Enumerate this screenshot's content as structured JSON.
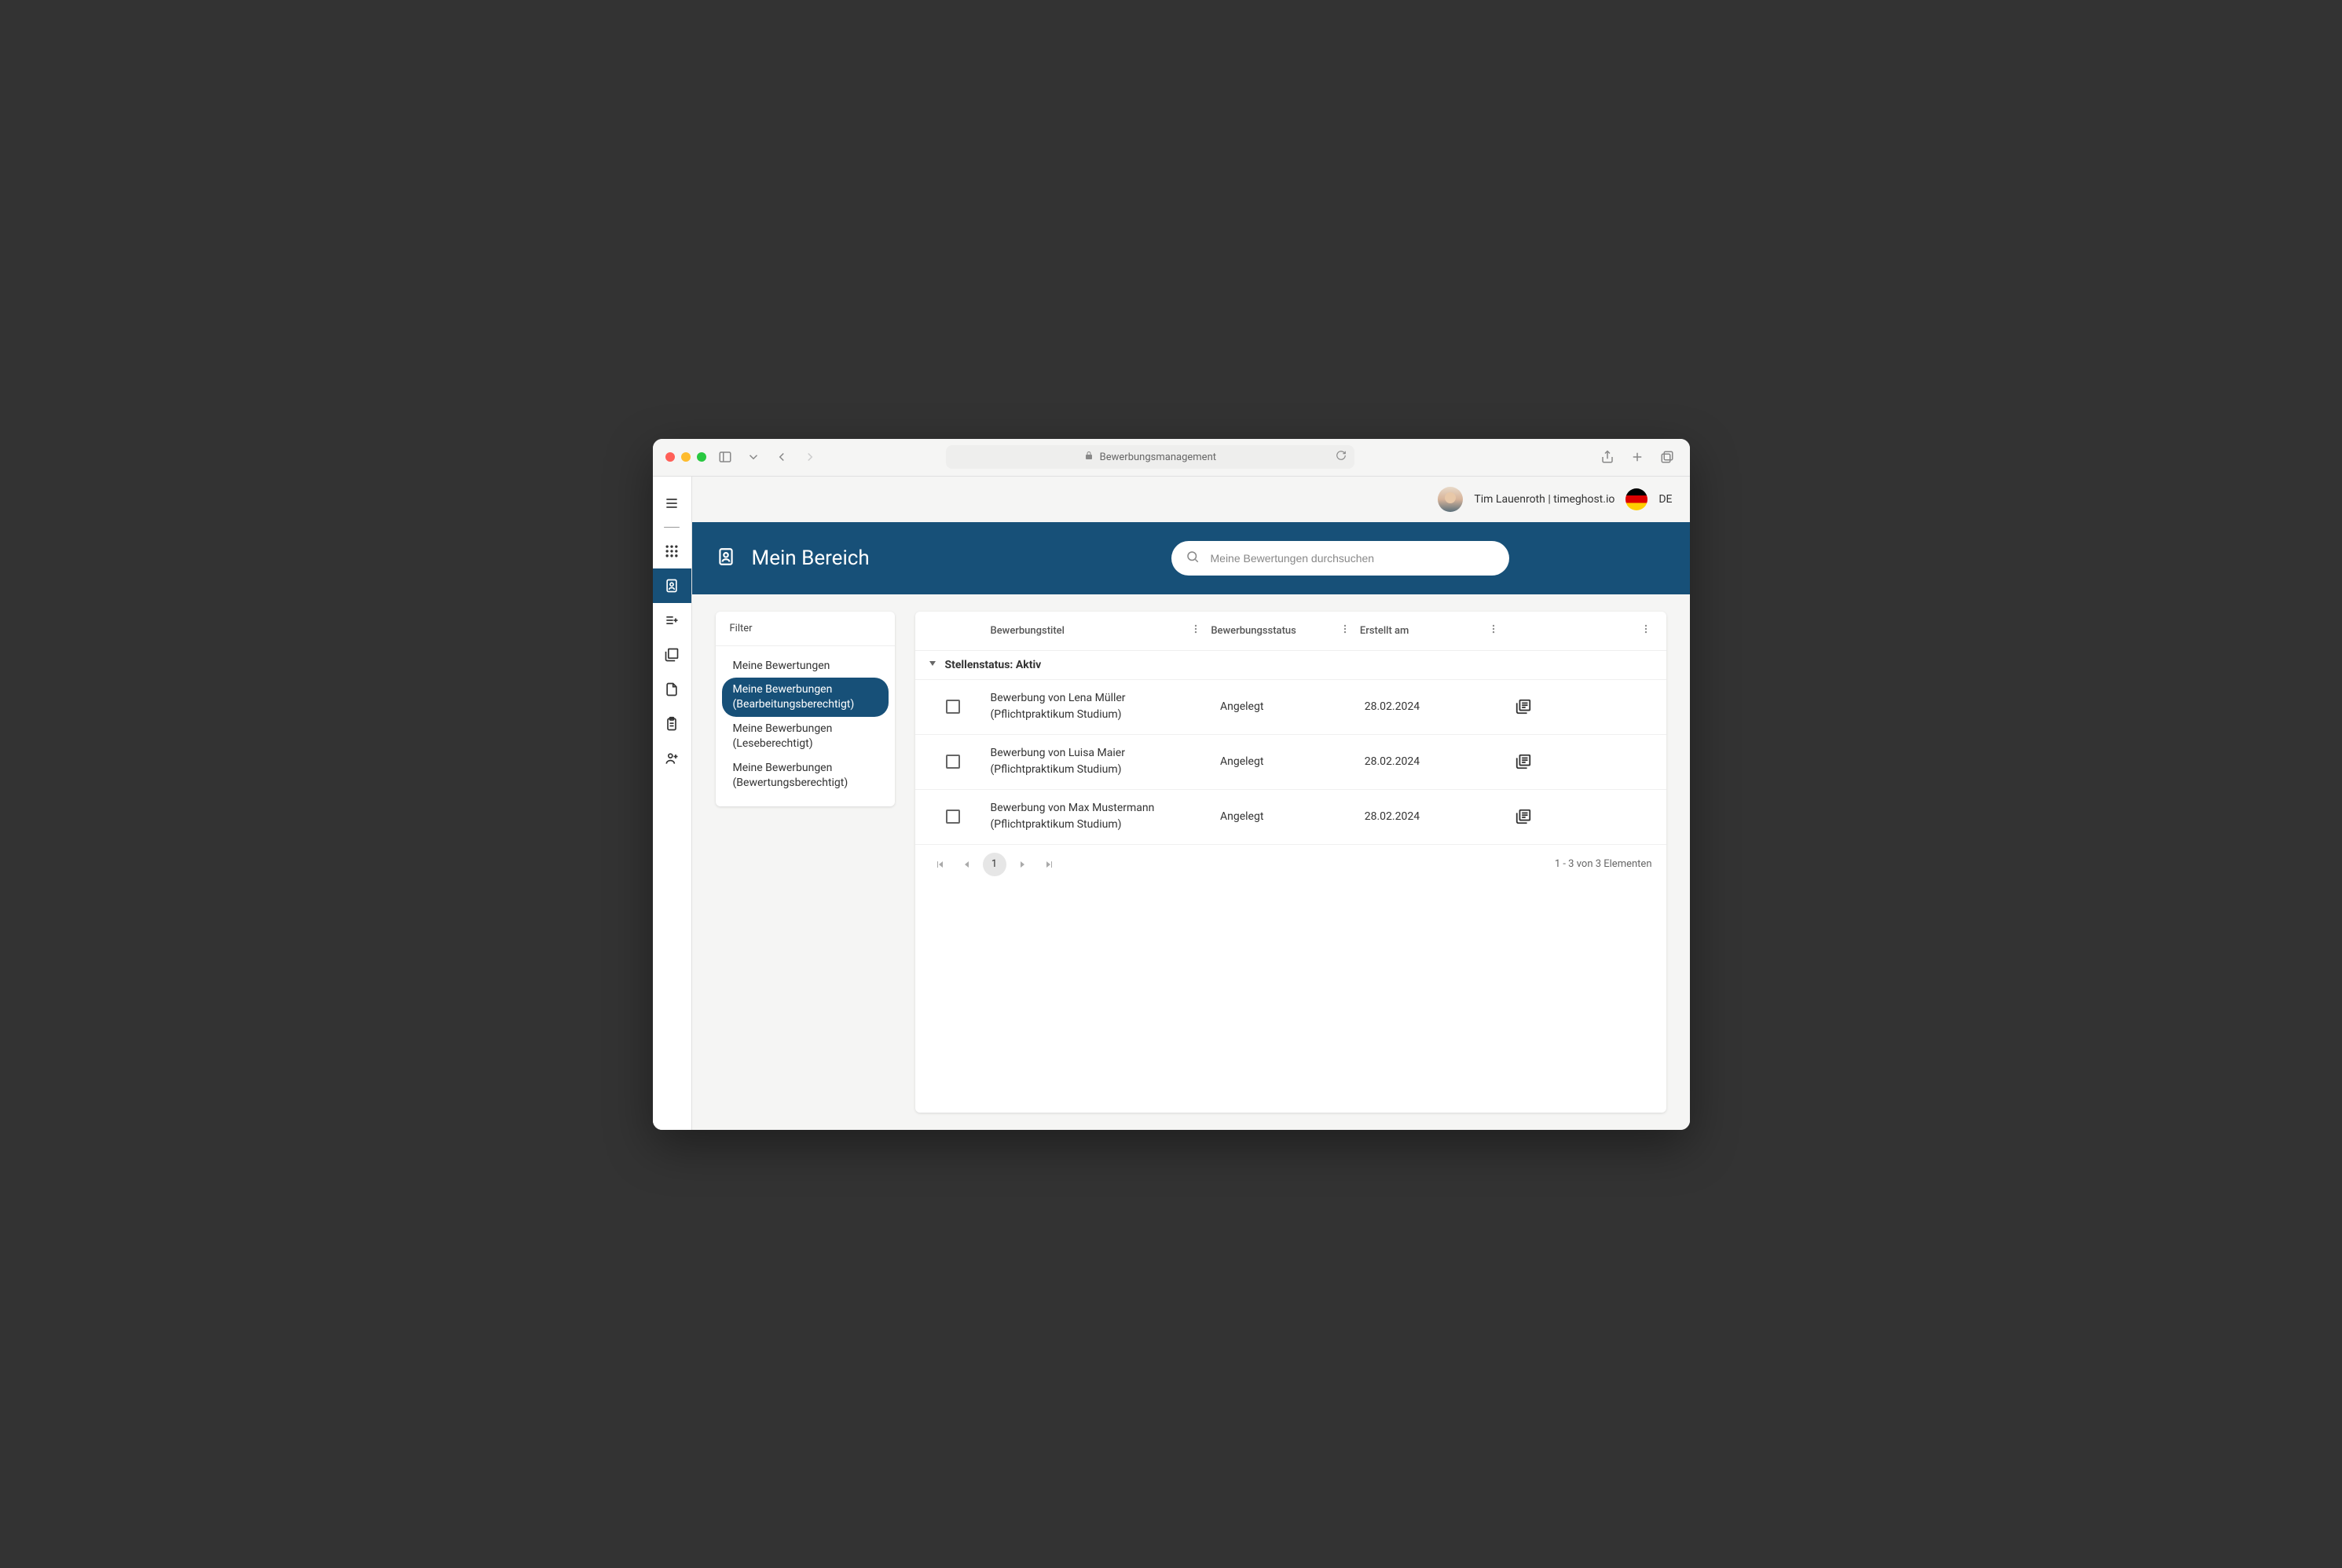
{
  "browser": {
    "page_title": "Bewerbungsmanagement"
  },
  "topbar": {
    "user_name": "Tim Lauenroth | timeghost.io",
    "language_code": "DE"
  },
  "hero": {
    "title": "Mein Bereich",
    "search_placeholder": "Meine Bewertungen durchsuchen"
  },
  "filter": {
    "heading": "Filter",
    "items": [
      {
        "label": "Meine Bewertungen",
        "active": false
      },
      {
        "label": "Meine Bewerbungen (Bearbeitungsberechtigt)",
        "active": true
      },
      {
        "label": "Meine Bewerbungen (Leseberechtigt)",
        "active": false
      },
      {
        "label": "Meine Bewerbungen (Bewertungsberechtigt)",
        "active": false
      }
    ]
  },
  "table": {
    "columns": {
      "title": "Bewerbungstitel",
      "status": "Bewerbungsstatus",
      "date": "Erstellt am"
    },
    "group_label": "Stellenstatus: Aktiv",
    "rows": [
      {
        "title": "Bewerbung von Lena Müller (Pflichtpraktikum Studium)",
        "status": "Angelegt",
        "date": "28.02.2024"
      },
      {
        "title": "Bewerbung von Luisa Maier (Pflichtpraktikum Studium)",
        "status": "Angelegt",
        "date": "28.02.2024"
      },
      {
        "title": "Bewerbung von Max Mustermann (Pflichtpraktikum Studium)",
        "status": "Angelegt",
        "date": "28.02.2024"
      }
    ]
  },
  "pagination": {
    "current_page": "1",
    "summary": "1 - 3 von 3 Elementen"
  }
}
